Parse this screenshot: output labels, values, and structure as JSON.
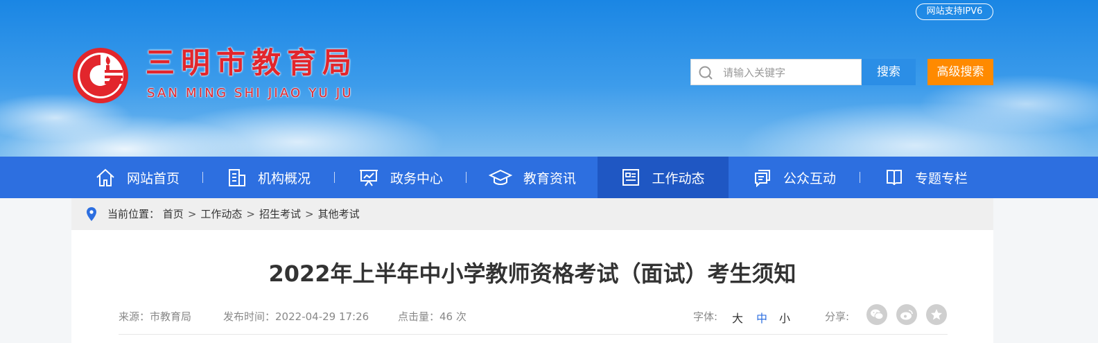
{
  "header": {
    "ipv6_badge": "网站支持IPV6",
    "site_name_cn": "三明市教育局",
    "site_name_en": "SAN MING SHI JIAO YU JU",
    "search_placeholder": "请输入关键字",
    "search_button": "搜索",
    "advanced_search_button": "高级搜索",
    "brand_red": "#e2262c"
  },
  "nav": {
    "items": [
      {
        "label": "网站首页",
        "icon": "home-icon"
      },
      {
        "label": "机构概况",
        "icon": "building-icon"
      },
      {
        "label": "政务中心",
        "icon": "presentation-icon"
      },
      {
        "label": "教育资讯",
        "icon": "graduation-cap-icon"
      },
      {
        "label": "工作动态",
        "icon": "newspaper-icon",
        "active": true
      },
      {
        "label": "公众互动",
        "icon": "chat-icon"
      },
      {
        "label": "专题专栏",
        "icon": "book-icon"
      }
    ],
    "color": "#2d6fe0",
    "active_color": "#1f57c3"
  },
  "breadcrumb": {
    "prefix": "当前位置：",
    "items": [
      "首页",
      "工作动态",
      "招生考试",
      "其他考试"
    ],
    "separator": ">"
  },
  "article": {
    "title": "2022年上半年中小学教师资格考试（面试）考生须知",
    "source_label": "来源：",
    "source": "市教育局",
    "publish_label": "发布时间：",
    "publish_time": "2022-04-29 17:26",
    "views_label": "点击量：",
    "views": "46 次",
    "font_label": "字体:",
    "font_large": "大",
    "font_medium": "中",
    "font_small": "小",
    "share_label": "分享:",
    "share_icons": [
      "wechat-icon",
      "weibo-icon",
      "star-icon"
    ]
  }
}
